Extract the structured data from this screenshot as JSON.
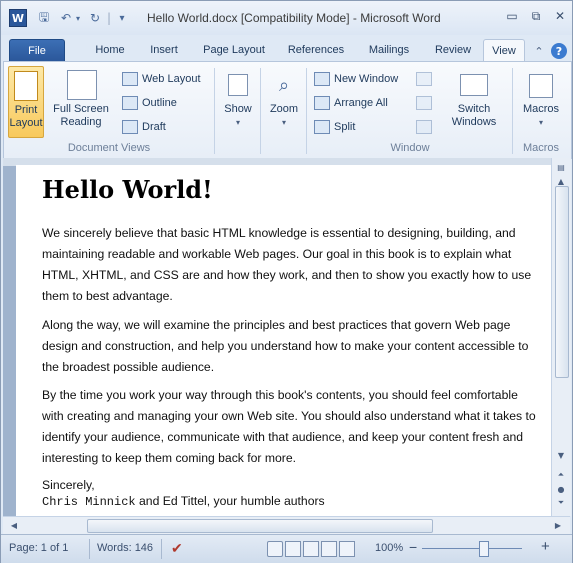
{
  "window": {
    "title": "Hello World.docx [Compatibility Mode] - Microsoft Word",
    "app_icon_letter": "W",
    "minimize": "▭",
    "restore": "⧉",
    "close": "✕"
  },
  "quick_access": {
    "save": "🖫",
    "undo": "↶",
    "undo_more": "▾",
    "redo": "↻",
    "customize": "▾"
  },
  "tabs": [
    "File",
    "Home",
    "Insert",
    "Page Layout",
    "References",
    "Mailings",
    "Review",
    "View"
  ],
  "active_tab": "View",
  "ribbon": {
    "document_views": {
      "group_label": "Document Views",
      "print_layout": [
        "Print",
        "Layout"
      ],
      "full_screen": [
        "Full Screen",
        "Reading"
      ],
      "web_layout": "Web Layout",
      "outline": "Outline",
      "draft": "Draft"
    },
    "show": {
      "label": "Show"
    },
    "zoom": {
      "label": "Zoom"
    },
    "window": {
      "group_label": "Window",
      "new_window": "New Window",
      "arrange_all": "Arrange All",
      "split": "Split",
      "switch_windows": [
        "Switch",
        "Windows"
      ]
    },
    "macros": {
      "group_label": "Macros",
      "label": "Macros"
    }
  },
  "document": {
    "heading": "Hello World!",
    "paragraphs": [
      "We sincerely believe that basic HTML knowledge is essential to designing, building, and maintaining readable and workable Web pages. Our goal in this book is to explain what HTML, XHTML, and CSS are and how they work, and then to show you exactly how to use them to best advantage.",
      "Along the way, we will examine the principles and best practices that govern Web page design and construction, and help you understand how to make your content accessible to the broadest possible audience.",
      "By the time you work your way through this book's contents, you should feel comfortable with creating and managing your own Web site. You should also understand what it takes to identify your audience, communicate with that audience, and keep your content fresh and interesting to keep them coming back for more."
    ],
    "closing": "Sincerely,",
    "signature_mono": "Chris Minnick",
    "signature_rest": " and Ed Tittel, your humble authors"
  },
  "status": {
    "page": "Page: 1 of 1",
    "words": "Words: 146",
    "zoom_level": "100%",
    "zoom_out": "−",
    "zoom_in": "+"
  }
}
